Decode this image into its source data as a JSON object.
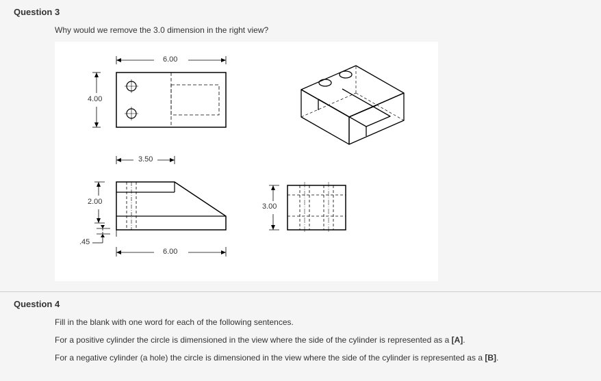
{
  "q3": {
    "title": "Question 3",
    "prompt": "Why would we remove the 3.0 dimension in the right view?",
    "dims": {
      "top_width": "6.00",
      "top_height": "4.00",
      "mid_width": "3.50",
      "front_height": "2.00",
      "front_ledge": ".45",
      "front_width": "6.00",
      "right_height": "3.00"
    }
  },
  "q4": {
    "title": "Question 4",
    "line1": "Fill in the blank with one word for each of the following sentences.",
    "line2_a": "For a positive cylinder the circle is dimensioned in the view where the side of the cylinder is represented as a ",
    "line2_b": "[A]",
    "line2_c": ".",
    "line3_a": "For a negative cylinder (a hole)  the circle is dimensioned in the view where the side of the cylinder is represented as a ",
    "line3_b": "[B]",
    "line3_c": "."
  }
}
